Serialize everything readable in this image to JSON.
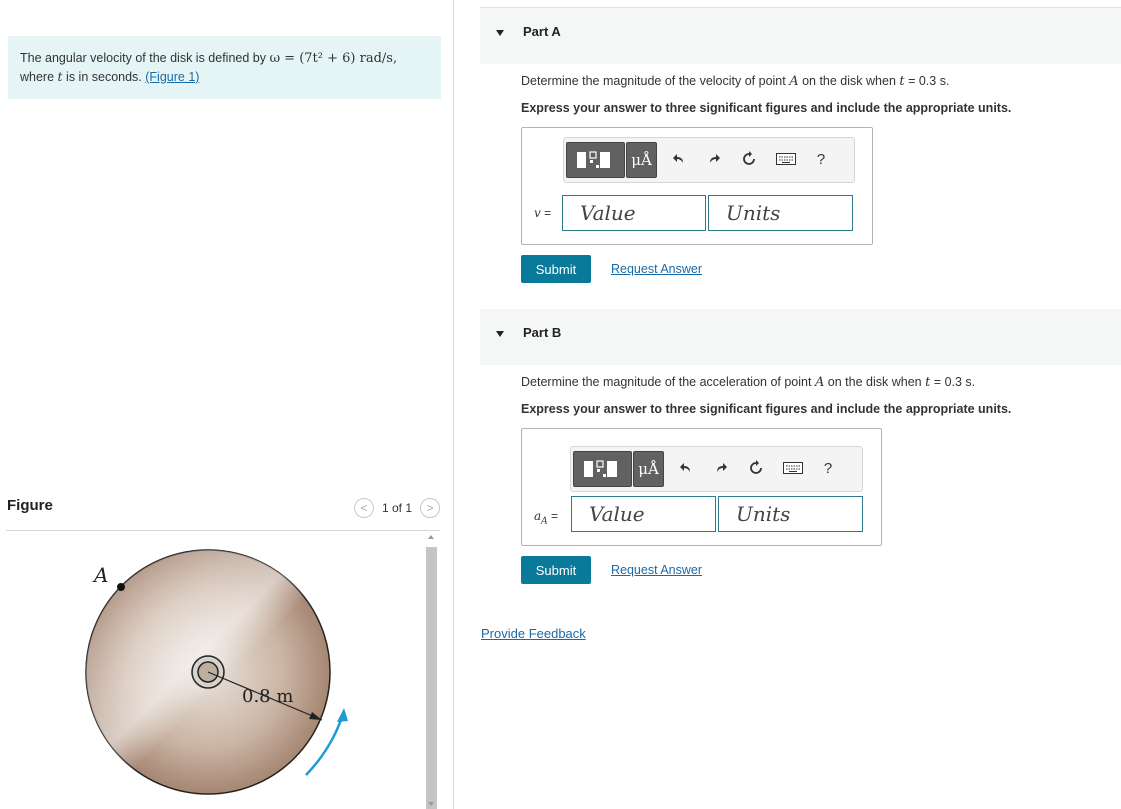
{
  "problem": {
    "text_before": "The angular velocity of the disk is defined by ",
    "omega_expr": "ω = (7t² + 6) rad/s,",
    "text_where": "where ",
    "t_var": "t",
    "text_after": " is in seconds. ",
    "figure_link": "(Figure 1)"
  },
  "figure": {
    "title": "Figure",
    "counter": "1 of 1",
    "prev_glyph": "<",
    "next_glyph": ">",
    "point_label": "A",
    "radius_label": "0.8 m"
  },
  "parts": [
    {
      "label": "Part A",
      "question_before": "Determine the magnitude of the velocity of point ",
      "point": "A",
      "question_mid": " on the disk when ",
      "t_var": "t",
      "question_after": " = 0.3 s.",
      "instruction": "Express your answer to three significant figures and include the appropriate units.",
      "var_symbol": "v",
      "var_eq": " =",
      "value_placeholder": "Value",
      "units_placeholder": "Units",
      "submit_label": "Submit",
      "request_label": "Request Answer"
    },
    {
      "label": "Part B",
      "question_before": "Determine the magnitude of the acceleration of point ",
      "point": "A",
      "question_mid": " on the disk when ",
      "t_var": "t",
      "question_after": " = 0.3 s.",
      "instruction": "Express your answer to three significant figures and include the appropriate units.",
      "var_symbol": "a",
      "var_sub": "A",
      "var_eq": " =",
      "value_placeholder": "Value",
      "units_placeholder": "Units",
      "submit_label": "Submit",
      "request_label": "Request Answer"
    }
  ],
  "toolbar": {
    "mu_label": "μÅ",
    "help_label": "?"
  },
  "feedback_label": "Provide Feedback",
  "colors": {
    "accent": "#0a7a9b",
    "problem_bg": "#e5f5f5",
    "link": "#1a6aa8"
  }
}
